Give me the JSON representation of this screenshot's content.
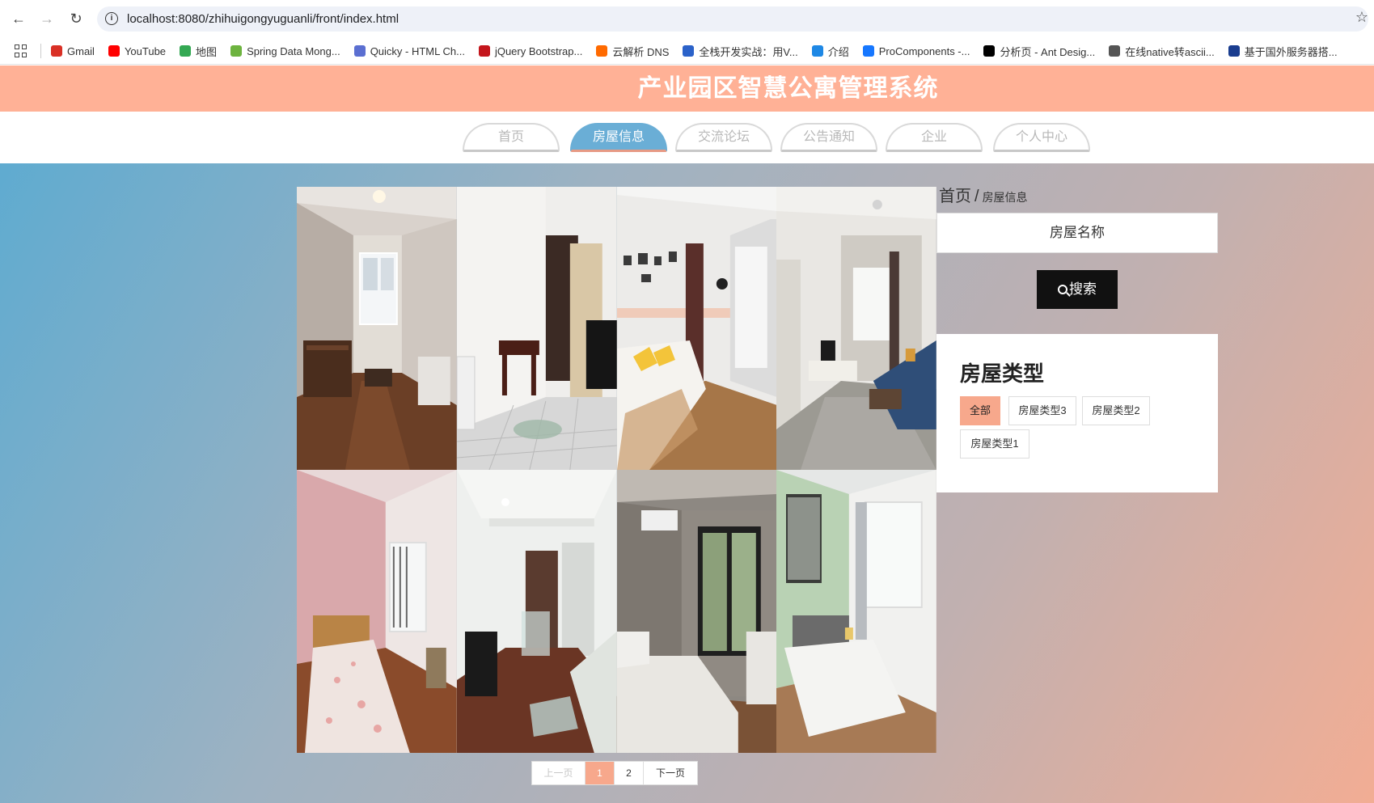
{
  "browser": {
    "url": "localhost:8080/zhihuigongyuguanli/front/index.html",
    "bookmarks": [
      {
        "label": "Gmail",
        "icon": "gmail-icon",
        "color": "#d93025"
      },
      {
        "label": "YouTube",
        "icon": "youtube-icon",
        "color": "#ff0000"
      },
      {
        "label": "地图",
        "icon": "maps-icon",
        "color": "#34a853"
      },
      {
        "label": "Spring Data Mong...",
        "icon": "spring-icon",
        "color": "#6db33f"
      },
      {
        "label": "Quicky - HTML Ch...",
        "icon": "quicky-icon",
        "color": "#5b6fd1"
      },
      {
        "label": "jQuery Bootstrap...",
        "icon": "jquery-icon",
        "color": "#c4161c"
      },
      {
        "label": "云解析 DNS",
        "icon": "aliyun-icon",
        "color": "#ff6a00"
      },
      {
        "label": "全栈开发实战：用V...",
        "icon": "m-icon",
        "color": "#2b62c9"
      },
      {
        "label": "介绍",
        "icon": "intro-icon",
        "color": "#1e88e5"
      },
      {
        "label": "ProComponents -...",
        "icon": "procomponents-icon",
        "color": "#1677ff"
      },
      {
        "label": "分析页 - Ant Desig...",
        "icon": "pro-icon",
        "color": "#000000"
      },
      {
        "label": "在线native转ascii...",
        "icon": "globe-icon",
        "color": "#555555"
      },
      {
        "label": "基于国外服务器搭...",
        "icon": "server-icon",
        "color": "#1a3d8f"
      }
    ]
  },
  "header": {
    "title": "产业园区智慧公寓管理系统"
  },
  "nav": {
    "items": [
      {
        "label": "首页"
      },
      {
        "label": "房屋信息"
      },
      {
        "label": "交流论坛"
      },
      {
        "label": "公告通知"
      },
      {
        "label": "企业"
      },
      {
        "label": "个人中心"
      }
    ],
    "active_index": 1
  },
  "breadcrumb": {
    "home": "首页",
    "separator": "/",
    "current": "房屋信息"
  },
  "search": {
    "placeholder": "房屋名称",
    "button_label": "搜索"
  },
  "house_types": {
    "title": "房屋类型",
    "tags": [
      {
        "label": "全部",
        "active": true
      },
      {
        "label": "房屋类型3",
        "active": false
      },
      {
        "label": "房屋类型2",
        "active": false
      },
      {
        "label": "房屋类型1",
        "active": false
      }
    ]
  },
  "pagination": {
    "prev": "上一页",
    "pages": [
      "1",
      "2"
    ],
    "current": "1",
    "next": "下一页"
  },
  "colors": {
    "header_bg": "#ffb196",
    "nav_active": "#6aaed6",
    "accent": "#f7a88c"
  }
}
